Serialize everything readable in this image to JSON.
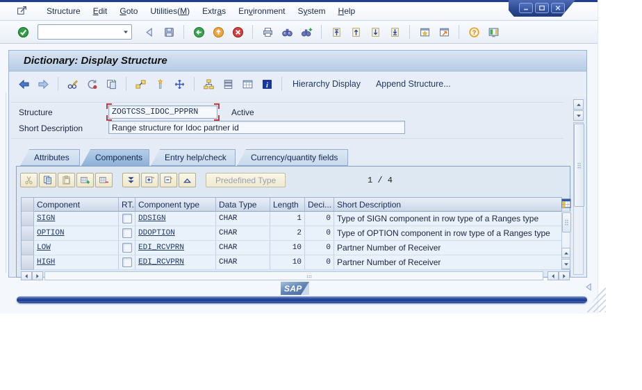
{
  "window_controls": {
    "buttons": [
      {
        "id": "minimize",
        "label": "Minimize"
      },
      {
        "id": "maximize",
        "label": "Maximize"
      },
      {
        "id": "close",
        "label": "Close"
      }
    ]
  },
  "menu_bar": {
    "items": [
      {
        "label": "Structure",
        "accel": -1
      },
      {
        "label": "Edit",
        "accel": 0
      },
      {
        "label": "Goto",
        "accel": 0
      },
      {
        "label": "Utilities(M)",
        "accel": 10
      },
      {
        "label": "Extras",
        "accel": 4
      },
      {
        "label": "Environment",
        "accel": 2
      },
      {
        "label": "System",
        "accel": 1
      },
      {
        "label": "Help",
        "accel": 0
      }
    ]
  },
  "standard_toolbar": {
    "command_field": {
      "value": "",
      "placeholder": ""
    },
    "icon_groups": [
      [
        "back-triangle",
        "save"
      ],
      [
        "nav-back",
        "nav-up",
        "cancel"
      ],
      [
        "print",
        "find",
        "find-next"
      ],
      [
        "first-page",
        "previous-page",
        "next-page",
        "last-page"
      ],
      [
        "new-session",
        "create-shortcut"
      ],
      [
        "help",
        "customize-layout"
      ]
    ]
  },
  "title_bar": {
    "title": "Dictionary: Display Structure"
  },
  "application_toolbar": {
    "icon_groups": [
      [
        "back-arrow",
        "forward-arrow"
      ],
      [
        "display-change",
        "refresh",
        "copy-object"
      ],
      [
        "where-used",
        "activate",
        "navigate"
      ],
      [
        "hierarchy",
        "stacked-view",
        "table-view",
        "info"
      ]
    ],
    "text_buttons": [
      "Hierarchy Display",
      "Append Structure..."
    ]
  },
  "form": {
    "structure_label": "Structure",
    "structure_value": "ZOGTCSS_IDOC_PPPRN",
    "structure_status": "Active",
    "short_description_label": "Short Description",
    "short_description_value": "Range structure for Idoc partner id"
  },
  "tab_strip": {
    "tabs": [
      {
        "label": "Attributes",
        "selected": false
      },
      {
        "label": "Components",
        "selected": true
      },
      {
        "label": "Entry help/check",
        "selected": false
      },
      {
        "label": "Currency/quantity fields",
        "selected": false
      }
    ]
  },
  "components_tab": {
    "toolbar": {
      "icon_groups": [
        [
          "cut",
          "copy",
          "paste",
          "insert-row",
          "delete-row"
        ],
        [
          "select-all",
          "expand-line",
          "collapse-line",
          "move-up"
        ]
      ],
      "disabled_icons": [
        "cut",
        "paste"
      ],
      "predefined_type_button": "Predefined Type",
      "row_counter": "1 / 4"
    },
    "table": {
      "columns": [
        "",
        "Component",
        "RT...",
        "Component type",
        "Data Type",
        "Length",
        "Deci...",
        "Short Description"
      ],
      "rows": [
        {
          "component": "SIGN",
          "rt_checked": false,
          "component_type": "DDSIGN",
          "data_type": "CHAR",
          "length": "1",
          "decimals": "0",
          "description": "Type of SIGN component in row type of a Ranges type"
        },
        {
          "component": "OPTION",
          "rt_checked": false,
          "component_type": "DDOPTION",
          "data_type": "CHAR",
          "length": "2",
          "decimals": "0",
          "description": "Type of OPTION component in row type of a Ranges type"
        },
        {
          "component": "LOW",
          "rt_checked": false,
          "component_type": "EDI_RCVPRN",
          "data_type": "CHAR",
          "length": "10",
          "decimals": "0",
          "description": "Partner Number of Receiver"
        },
        {
          "component": "HIGH",
          "rt_checked": false,
          "component_type": "EDI_RCVPRN",
          "data_type": "CHAR",
          "length": "10",
          "decimals": "0",
          "description": "Partner Number of Receiver"
        }
      ]
    }
  },
  "footer": {
    "sap_logo_text": "SAP"
  },
  "colors": {
    "accent_navy": "#1f3864",
    "status_bar_blue": "#24418f",
    "selected_tab_blue": "#8fb2da",
    "link_color": "#1f3864",
    "toolbar_button_bg": "#f3f0da",
    "title_bar_blue": "#b6cbe4"
  }
}
